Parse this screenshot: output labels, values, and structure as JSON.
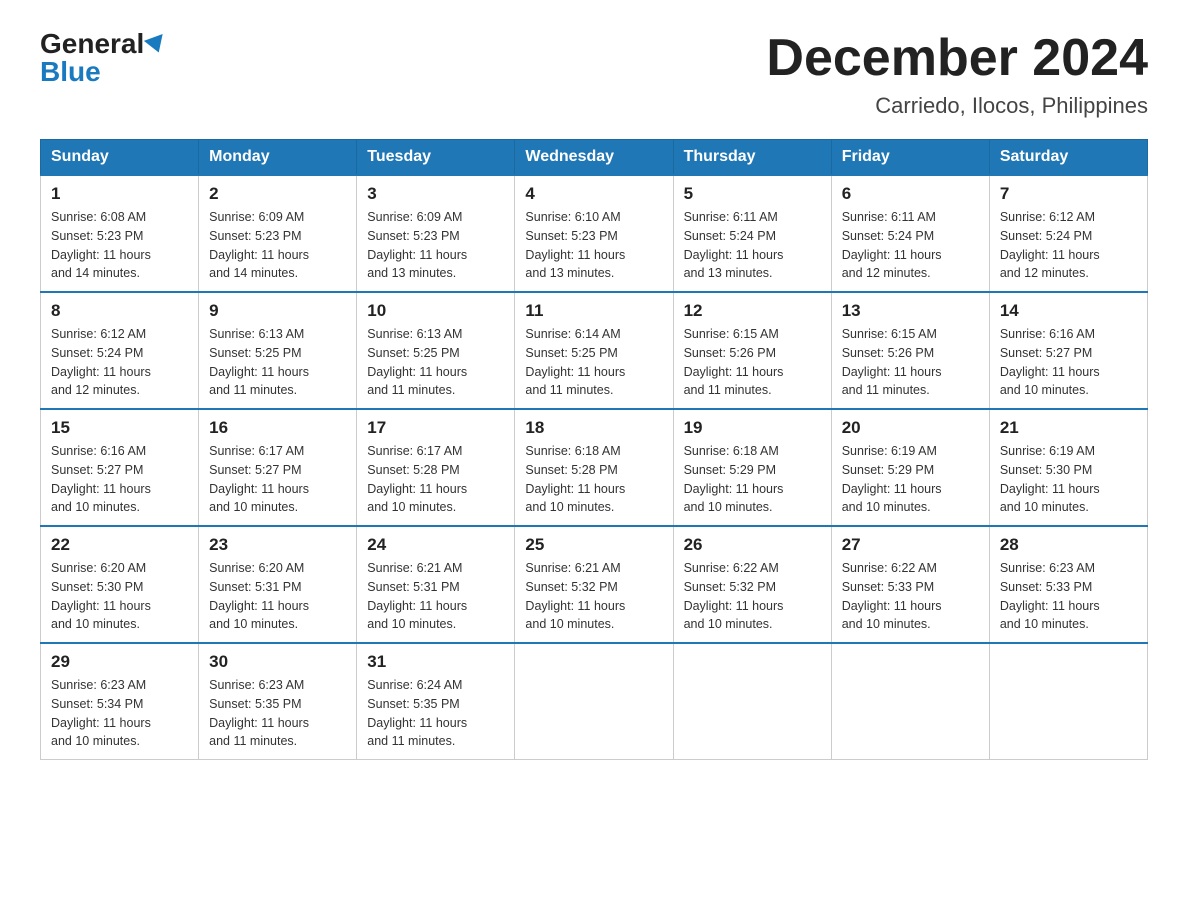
{
  "header": {
    "logo_general": "General",
    "logo_blue": "Blue",
    "month_title": "December 2024",
    "location": "Carriedo, Ilocos, Philippines"
  },
  "weekdays": [
    "Sunday",
    "Monday",
    "Tuesday",
    "Wednesday",
    "Thursday",
    "Friday",
    "Saturday"
  ],
  "weeks": [
    [
      {
        "day": "1",
        "sunrise": "6:08 AM",
        "sunset": "5:23 PM",
        "daylight": "11 hours and 14 minutes."
      },
      {
        "day": "2",
        "sunrise": "6:09 AM",
        "sunset": "5:23 PM",
        "daylight": "11 hours and 14 minutes."
      },
      {
        "day": "3",
        "sunrise": "6:09 AM",
        "sunset": "5:23 PM",
        "daylight": "11 hours and 13 minutes."
      },
      {
        "day": "4",
        "sunrise": "6:10 AM",
        "sunset": "5:23 PM",
        "daylight": "11 hours and 13 minutes."
      },
      {
        "day": "5",
        "sunrise": "6:11 AM",
        "sunset": "5:24 PM",
        "daylight": "11 hours and 13 minutes."
      },
      {
        "day": "6",
        "sunrise": "6:11 AM",
        "sunset": "5:24 PM",
        "daylight": "11 hours and 12 minutes."
      },
      {
        "day": "7",
        "sunrise": "6:12 AM",
        "sunset": "5:24 PM",
        "daylight": "11 hours and 12 minutes."
      }
    ],
    [
      {
        "day": "8",
        "sunrise": "6:12 AM",
        "sunset": "5:24 PM",
        "daylight": "11 hours and 12 minutes."
      },
      {
        "day": "9",
        "sunrise": "6:13 AM",
        "sunset": "5:25 PM",
        "daylight": "11 hours and 11 minutes."
      },
      {
        "day": "10",
        "sunrise": "6:13 AM",
        "sunset": "5:25 PM",
        "daylight": "11 hours and 11 minutes."
      },
      {
        "day": "11",
        "sunrise": "6:14 AM",
        "sunset": "5:25 PM",
        "daylight": "11 hours and 11 minutes."
      },
      {
        "day": "12",
        "sunrise": "6:15 AM",
        "sunset": "5:26 PM",
        "daylight": "11 hours and 11 minutes."
      },
      {
        "day": "13",
        "sunrise": "6:15 AM",
        "sunset": "5:26 PM",
        "daylight": "11 hours and 11 minutes."
      },
      {
        "day": "14",
        "sunrise": "6:16 AM",
        "sunset": "5:27 PM",
        "daylight": "11 hours and 10 minutes."
      }
    ],
    [
      {
        "day": "15",
        "sunrise": "6:16 AM",
        "sunset": "5:27 PM",
        "daylight": "11 hours and 10 minutes."
      },
      {
        "day": "16",
        "sunrise": "6:17 AM",
        "sunset": "5:27 PM",
        "daylight": "11 hours and 10 minutes."
      },
      {
        "day": "17",
        "sunrise": "6:17 AM",
        "sunset": "5:28 PM",
        "daylight": "11 hours and 10 minutes."
      },
      {
        "day": "18",
        "sunrise": "6:18 AM",
        "sunset": "5:28 PM",
        "daylight": "11 hours and 10 minutes."
      },
      {
        "day": "19",
        "sunrise": "6:18 AM",
        "sunset": "5:29 PM",
        "daylight": "11 hours and 10 minutes."
      },
      {
        "day": "20",
        "sunrise": "6:19 AM",
        "sunset": "5:29 PM",
        "daylight": "11 hours and 10 minutes."
      },
      {
        "day": "21",
        "sunrise": "6:19 AM",
        "sunset": "5:30 PM",
        "daylight": "11 hours and 10 minutes."
      }
    ],
    [
      {
        "day": "22",
        "sunrise": "6:20 AM",
        "sunset": "5:30 PM",
        "daylight": "11 hours and 10 minutes."
      },
      {
        "day": "23",
        "sunrise": "6:20 AM",
        "sunset": "5:31 PM",
        "daylight": "11 hours and 10 minutes."
      },
      {
        "day": "24",
        "sunrise": "6:21 AM",
        "sunset": "5:31 PM",
        "daylight": "11 hours and 10 minutes."
      },
      {
        "day": "25",
        "sunrise": "6:21 AM",
        "sunset": "5:32 PM",
        "daylight": "11 hours and 10 minutes."
      },
      {
        "day": "26",
        "sunrise": "6:22 AM",
        "sunset": "5:32 PM",
        "daylight": "11 hours and 10 minutes."
      },
      {
        "day": "27",
        "sunrise": "6:22 AM",
        "sunset": "5:33 PM",
        "daylight": "11 hours and 10 minutes."
      },
      {
        "day": "28",
        "sunrise": "6:23 AM",
        "sunset": "5:33 PM",
        "daylight": "11 hours and 10 minutes."
      }
    ],
    [
      {
        "day": "29",
        "sunrise": "6:23 AM",
        "sunset": "5:34 PM",
        "daylight": "11 hours and 10 minutes."
      },
      {
        "day": "30",
        "sunrise": "6:23 AM",
        "sunset": "5:35 PM",
        "daylight": "11 hours and 11 minutes."
      },
      {
        "day": "31",
        "sunrise": "6:24 AM",
        "sunset": "5:35 PM",
        "daylight": "11 hours and 11 minutes."
      },
      null,
      null,
      null,
      null
    ]
  ],
  "labels": {
    "sunrise": "Sunrise:",
    "sunset": "Sunset:",
    "daylight": "Daylight:"
  }
}
